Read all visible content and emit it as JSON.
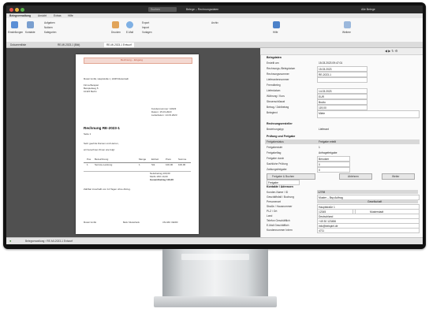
{
  "window": {
    "title": "Belege – Rechnungsdaten",
    "search_placeholder": "Suchen",
    "user": "Alle Belege"
  },
  "ribbon_tabs": [
    "Belegverwaltung",
    "Ansicht",
    "Extras",
    "Hilfe"
  ],
  "ribbon_buttons": [
    "Einstellungen",
    "Kontakte",
    "Aufgaben",
    "Notizen",
    "Kategorien",
    "Drucken",
    "E-Mail",
    "Export",
    "Import",
    "Vorlagen",
    "Archiv",
    "Hilfe",
    "Weitere"
  ],
  "doc_tabs": [
    "Dokumentliste",
    "RE-MI-2023-1 (Bild)",
    "RE-MI-2023-1 Entwurf"
  ],
  "invoice": {
    "header_stamp": "Rechnung – Eingang",
    "sender": "Muster GmbH, Hauptstraße 1, 12345 Musterstadt",
    "recipient_lines": [
      "Firma Beispiel",
      "Beispielweg 5",
      "10115 Berlin"
    ],
    "meta_lines": [
      "Kundennummer: 10023",
      "Datum: 15.03.2023",
      "Lieferdatum: 14.03.2023"
    ],
    "title": "Rechnung RE-2023-1",
    "subtitle": "Seite 1",
    "greeting": "Sehr geehrte Damen und Herren,",
    "intro": "wir berechnen Ihnen wie folgt:",
    "table_headers": [
      "Pos",
      "Bezeichnung",
      "Menge",
      "Einheit",
      "Preis",
      "Summe"
    ],
    "table_rows": [
      [
        "1",
        "Service-Leistung",
        "1",
        "Stk",
        "100,00",
        "100,00"
      ]
    ],
    "totals": [
      "Nettobetrag 100,00",
      "MwSt 19% 19,00",
      "Gesamtbetrag 119,00"
    ],
    "footer_note": "Zahlbar innerhalb von 14 Tagen ohne Abzug.",
    "footer_cols": [
      "Muster GmbH",
      "Bank: Musterbank",
      "USt-IdNr: DE000"
    ]
  },
  "panel": {
    "section_belegdaten": "Belegdaten",
    "fields": [
      {
        "label": "Erstellt am",
        "value": "15.03.2023 09:47:01"
      },
      {
        "label": "Rechnungs-/Belegdatum",
        "value": "15.03.2023"
      },
      {
        "label": "Rechnungsnummer",
        "value": "RE-2023-1"
      },
      {
        "label": "Lieferantennummer",
        "value": ""
      },
      {
        "label": "Fremdbeleg",
        "value": ""
      },
      {
        "label": "Lieferdatum",
        "value": "14.03.2023"
      },
      {
        "label": "Währung / Kurs",
        "value": "EUR"
      },
      {
        "label": "Steuerschlüssel",
        "value": "Brutto"
      },
      {
        "label": "Betrag / Zahlbetrag",
        "value": "119,00"
      },
      {
        "label": "Belegtext",
        "value": "Miete"
      }
    ],
    "section_person": "Rechnungsersteller",
    "person_label": "Beziehungstyp",
    "person_value": "Lieferant",
    "section_pruefung": "Prüfung und Freigabe",
    "pruef_fields": [
      {
        "label": "Freigabestatus",
        "value": "Freigabe erteilt"
      },
      {
        "label": "Freigabestufe",
        "value": "1"
      },
      {
        "label": "Freigabeflag",
        "value": "Anfragefreigabe"
      },
      {
        "label": "Freigabe durch",
        "value": "Benutzer"
      },
      {
        "label": "Sachliche Prüfung",
        "value": "0"
      },
      {
        "label": "Zahlungsfreigabe",
        "value": "0"
      }
    ],
    "buttons": [
      "Freigabe & Buchen",
      "Ablehnen",
      "Weiter"
    ],
    "dropdown_value": "Freigabe",
    "section_kontakt": "Kontakte / Adressen",
    "kontakt_fields": [
      {
        "label": "Kunden-Name / ID",
        "value": "12798"
      },
      {
        "label": "Geschäftsfall / Buchung",
        "value": "Muster – Bsp Auftrag"
      },
      {
        "label": "Personenart",
        "value": "Gesellschaft"
      },
      {
        "label": "Straße / Hausnummer",
        "value": "Hauptstraße 1"
      },
      {
        "label": "PLZ / Ort",
        "value": "12345"
      },
      {
        "label": "Land",
        "value": "Deutschland"
      },
      {
        "label": "Telefon Geschäftlich",
        "value": "+49 30 123456"
      },
      {
        "label": "E-Mail Geschäftlich",
        "value": "info@beispiel.de"
      },
      {
        "label": "Kundennummer Intern",
        "value": "4711"
      }
    ],
    "city": "Musterstadt"
  },
  "statusbar": {
    "path": "Belegverwaltung › RE-MI-2023-1 Entwurf"
  }
}
